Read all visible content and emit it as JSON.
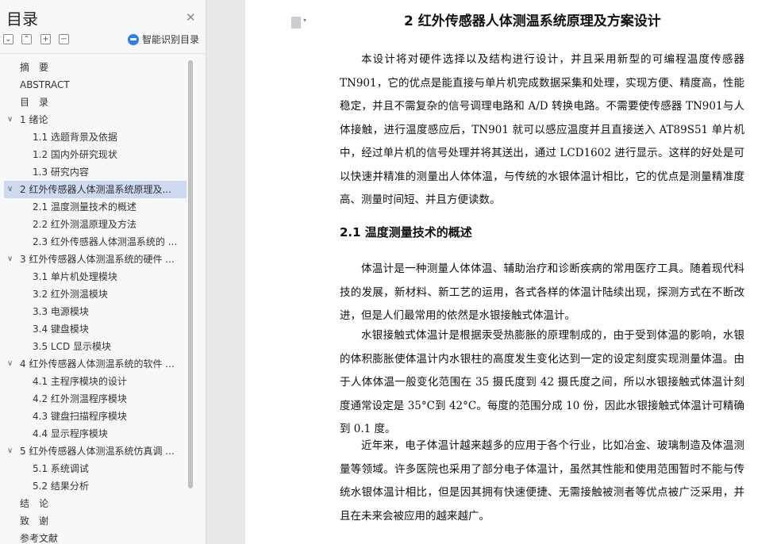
{
  "sidebar": {
    "title": "目录",
    "smart_label": "智能识别目录",
    "toc": [
      {
        "label": "摘　要",
        "level": 0,
        "arrow": ""
      },
      {
        "label": "ABSTRACT",
        "level": 0,
        "arrow": ""
      },
      {
        "label": "目　录",
        "level": 0,
        "arrow": ""
      },
      {
        "label": "1 绪论",
        "level": 0,
        "arrow": "∨"
      },
      {
        "label": "1.1 选题背景及依据",
        "level": 1,
        "arrow": ""
      },
      {
        "label": "1.2 国内外研究现状",
        "level": 1,
        "arrow": ""
      },
      {
        "label": "1.3 研究内容",
        "level": 1,
        "arrow": ""
      },
      {
        "label": "2 红外传感器人体测温系统原理及...",
        "level": 0,
        "arrow": "∨",
        "selected": true
      },
      {
        "label": "2.1 温度测量技术的概述",
        "level": 1,
        "arrow": ""
      },
      {
        "label": "2.2 红外测温原理及方法",
        "level": 1,
        "arrow": ""
      },
      {
        "label": "2.3 红外传感器人体测温系统的 ...",
        "level": 1,
        "arrow": ""
      },
      {
        "label": "3 红外传感器人体测温系统的硬件 ...",
        "level": 0,
        "arrow": "∨"
      },
      {
        "label": "3.1 单片机处理模块",
        "level": 1,
        "arrow": ""
      },
      {
        "label": "3.2 红外测温模块",
        "level": 1,
        "arrow": ""
      },
      {
        "label": "3.3 电源模块",
        "level": 1,
        "arrow": ""
      },
      {
        "label": "3.4 键盘模块",
        "level": 1,
        "arrow": ""
      },
      {
        "label": "3.5 LCD 显示模块",
        "level": 1,
        "arrow": ""
      },
      {
        "label": "4 红外传感器人体测温系统的软件 ...",
        "level": 0,
        "arrow": "∨"
      },
      {
        "label": "4.1 主程序模块的设计",
        "level": 1,
        "arrow": ""
      },
      {
        "label": "4.2 红外测温程序模块",
        "level": 1,
        "arrow": ""
      },
      {
        "label": "4.3 键盘扫描程序模块",
        "level": 1,
        "arrow": ""
      },
      {
        "label": "4.4 显示程序模块",
        "level": 1,
        "arrow": ""
      },
      {
        "label": "5 红外传感器人体测温系统仿真调 ...",
        "level": 0,
        "arrow": "∨"
      },
      {
        "label": "5.1 系统调试",
        "level": 1,
        "arrow": ""
      },
      {
        "label": "5.2 结果分析",
        "level": 1,
        "arrow": ""
      },
      {
        "label": "结　论",
        "level": 0,
        "arrow": ""
      },
      {
        "label": "致　谢",
        "level": 0,
        "arrow": ""
      },
      {
        "label": "参考文献",
        "level": 0,
        "arrow": ""
      }
    ]
  },
  "document": {
    "title": "2  红外传感器人体测温系统原理及方案设计",
    "para1": "本设计将对硬件选择以及结构进行设计，并且采用新型的可编程温度传感器TN901，它的优点是能直接与单片机完成数据采集和处理，实现方便、精度高，性能稳定，并且不需复杂的信号调理电路和 A/D 转换电路。不需要使传感器 TN901与人体接触，进行温度感应后，TN901 就可以感应温度并且直接送入 AT89S51 单片机中，经过单片机的信号处理并将其送出，通过 LCD1602 进行显示。这样的好处是可以快速并精准的测量出人体体温，与传统的水银体温计相比，它的优点是测量精准度高、测量时间短、并且方便读数。",
    "h21": "2.1 温度测量技术的概述",
    "para2": "体温计是一种测量人体体温、辅助治疗和诊断疾病的常用医疗工具。随着现代科技的发展，新材料、新工艺的运用，各式各样的体温计陆续出现，探测方式在不断改进，但是人们最常用的依然是水银接触式体温计。",
    "para3": "水银接触式体温计是根据汞受热膨胀的原理制成的，由于受到体温的影响，水银的体积膨胀使体温计内水银柱的高度发生变化达到一定的设定刻度实现测量体温。由于人体体温一般变化范围在 35 摄氏度到 42 摄氏度之间，所以水银接触式体温计刻度通常设定是 35°C到 42°C。每度的范围分成 10 份，因此水银接触式体温计可精确到 0.1 度。",
    "para4": "近年来，电子体温计越来越多的应用于各个行业，比如冶金、玻璃制造及体温测量等领域。许多医院也采用了部分电子体温计，虽然其性能和使用范围暂时不能与传统水银体温计相比，但是因其拥有快速便捷、无需接触被测者等优点被广泛采用，并且在未来会被应用的越来越广。"
  }
}
